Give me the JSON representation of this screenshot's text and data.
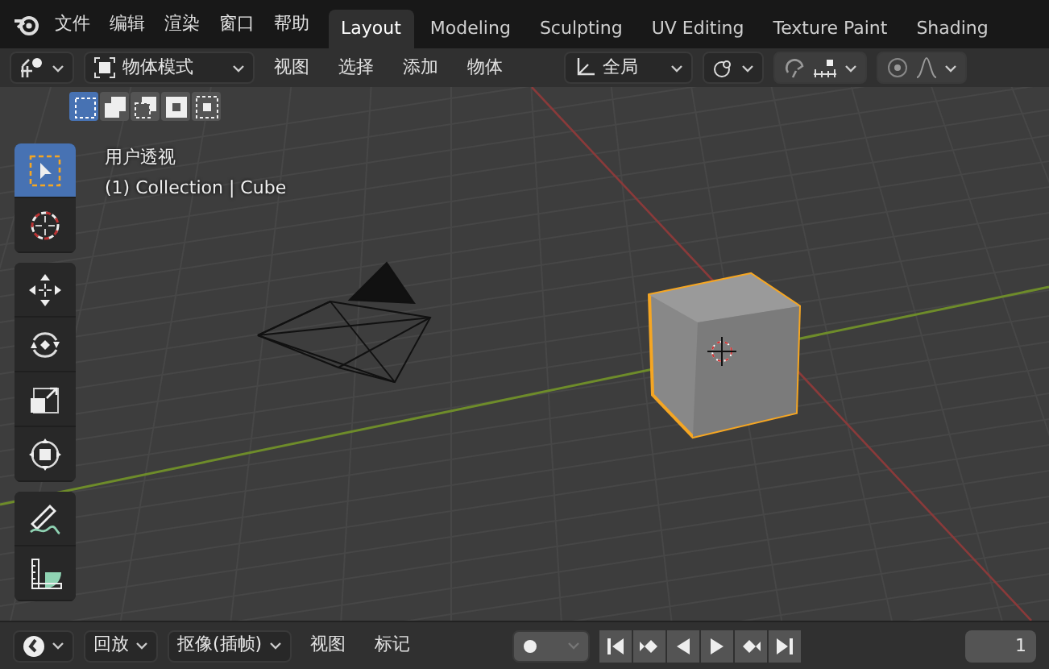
{
  "menu": {
    "items": [
      "文件",
      "编辑",
      "渲染",
      "窗口",
      "帮助"
    ]
  },
  "workspace_tabs": [
    {
      "label": "Layout",
      "selected": true
    },
    {
      "label": "Modeling",
      "selected": false
    },
    {
      "label": "Sculpting",
      "selected": false
    },
    {
      "label": "UV Editing",
      "selected": false
    },
    {
      "label": "Texture Paint",
      "selected": false
    },
    {
      "label": "Shading",
      "selected": false
    }
  ],
  "header": {
    "mode": "物体模式",
    "menus": [
      "视图",
      "选择",
      "添加",
      "物体"
    ],
    "orientation": "全局"
  },
  "select_modes": [
    {
      "kind": "new",
      "selected": true
    },
    {
      "kind": "extend",
      "selected": false
    },
    {
      "kind": "subtract",
      "selected": false
    },
    {
      "kind": "invert",
      "selected": false
    },
    {
      "kind": "intersect",
      "selected": false
    }
  ],
  "viewport": {
    "view_name": "用户透视",
    "object_info": "(1) Collection | Cube"
  },
  "tool_groups": [
    {
      "tools": [
        {
          "kind": "select",
          "selected": true
        },
        {
          "kind": "cursor",
          "selected": false
        }
      ]
    },
    {
      "tools": [
        {
          "kind": "move",
          "selected": false
        },
        {
          "kind": "rotate",
          "selected": false
        },
        {
          "kind": "scale",
          "selected": false
        },
        {
          "kind": "transform",
          "selected": false
        }
      ]
    },
    {
      "tools": [
        {
          "kind": "annotate",
          "selected": false
        },
        {
          "kind": "measure",
          "selected": false
        }
      ]
    }
  ],
  "timeline": {
    "playback": "回放",
    "keying": "抠像(插帧)",
    "menus": [
      "视图",
      "标记"
    ],
    "current_frame": "1"
  }
}
